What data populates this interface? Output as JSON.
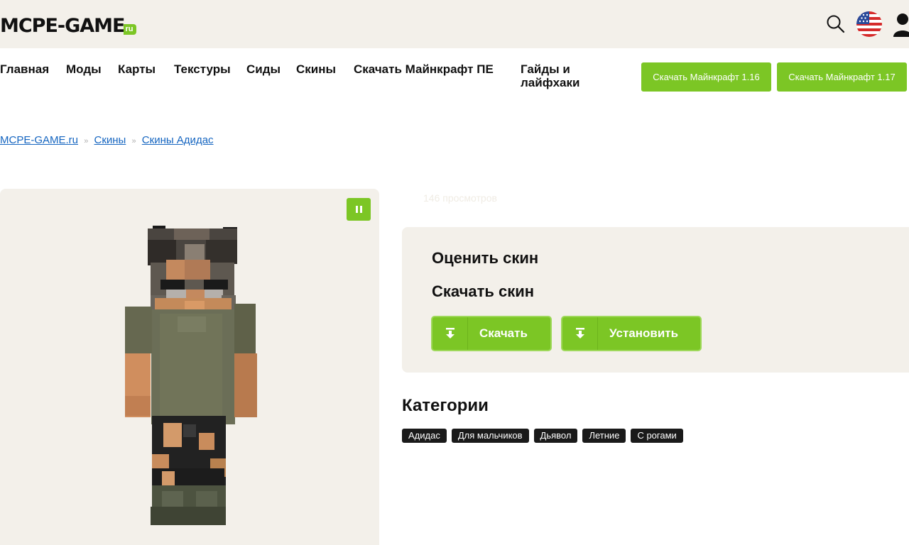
{
  "header": {
    "logo_main": "MCPE-GAME",
    "logo_suffix": "ru"
  },
  "nav": {
    "items": [
      "Главная",
      "Моды",
      "Карты",
      "Текстуры",
      "Сиды",
      "Скины",
      "Скачать Майнкрафт ПЕ",
      "Гайды и лайфхаки"
    ],
    "buttons": [
      "Скачать Майнкрафт 1.16",
      "Скачать Майнкрафт 1.17"
    ]
  },
  "breadcrumb": {
    "items": [
      "MCPE-GAME.ru",
      "Скины",
      "Скины Адидас"
    ],
    "separator": "»"
  },
  "stats": {
    "views": "146 просмотров"
  },
  "actions": {
    "rate_title": "Оценить скин",
    "download_title": "Скачать скин",
    "download_label": "Скачать",
    "install_label": "Установить"
  },
  "categories": {
    "title": "Категории",
    "tags": [
      "Адидас",
      "Для мальчиков",
      "Дьявол",
      "Летние",
      "С рогами"
    ]
  },
  "colors": {
    "accent": "#7cc625",
    "panel": "#f3f0ea",
    "link": "#1565c0",
    "tag_bg": "#1a1a1a"
  },
  "icons": {
    "search": "search-icon",
    "flag": "us-flag-icon",
    "user": "user-icon",
    "pause": "pause-icon",
    "download": "download-icon"
  }
}
